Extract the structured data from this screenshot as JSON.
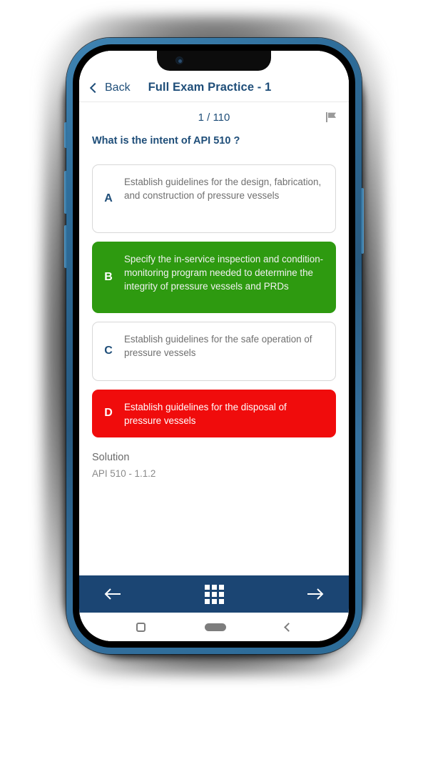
{
  "app": {
    "header": {
      "back_label": "Back",
      "title": "Full Exam Practice - 1",
      "back_icon": "chevron-left-icon"
    },
    "meta": {
      "progress": "1 / 110",
      "flag_icon": "flag-icon"
    },
    "question": {
      "text": "What is the intent of API 510 ?"
    },
    "options": [
      {
        "letter": "A",
        "text": "Establish guidelines for the design, fabrication, and construction of pressure vessels",
        "state": "neutral"
      },
      {
        "letter": "B",
        "text": "Specify the in-service inspection and condition-monitoring program needed to determine the integrity of pressure vessels and PRDs",
        "state": "correct"
      },
      {
        "letter": "C",
        "text": "Establish guidelines for the safe operation of pressure vessels",
        "state": "neutral"
      },
      {
        "letter": "D",
        "text": "Establish guidelines for the disposal of pressure vessels",
        "state": "wrong"
      }
    ],
    "solution": {
      "title": "Solution",
      "body": "API 510 - 1.1.2"
    },
    "bottom_nav": {
      "prev_icon": "arrow-left-icon",
      "grid_icon": "grid-3x3-icon",
      "next_icon": "arrow-right-icon"
    },
    "system_nav": {
      "recent_icon": "square-recent-apps-icon",
      "home_icon": "home-pill-icon",
      "back_icon": "chevron-left-icon"
    }
  },
  "device": {
    "notch": {
      "camera_icon": "front-camera-icon",
      "speaker_icon": "earpiece-speaker-icon"
    },
    "buttons": {
      "mute": "mute-switch",
      "volume_up": "volume-up-button",
      "volume_down": "volume-down-button",
      "power": "power-button"
    }
  },
  "colors": {
    "brand_navy": "#1f4e79",
    "nav_navy": "#1b4573",
    "correct_green": "#2e9a10",
    "wrong_red": "#f00c0c",
    "frame_blue": "#2f6e9b",
    "muted_text": "#6f6f6f"
  }
}
